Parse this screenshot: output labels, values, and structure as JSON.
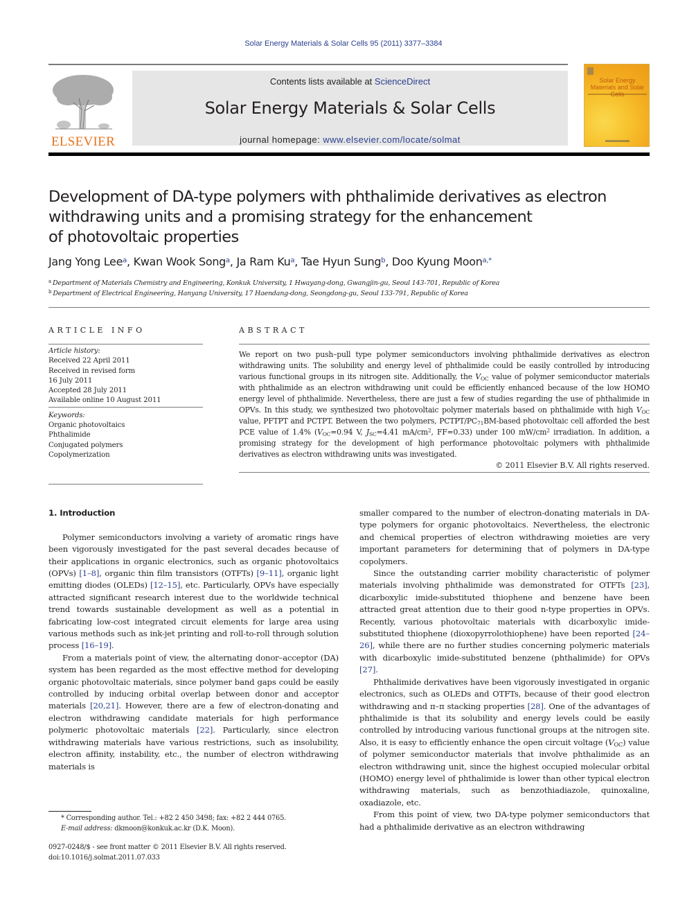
{
  "journal_reference": "Solar Energy Materials & Solar Cells 95 (2011) 3377–3384",
  "masthead": {
    "publisher_wordmark": "ELSEVIER",
    "contents_prefix": "Contents lists available at ",
    "contents_link": "ScienceDirect",
    "journal_name": "Solar Energy Materials & Solar Cells",
    "homepage_prefix": "journal homepage: ",
    "homepage_link": "www.elsevier.com/locate/solmat",
    "cover_title": "Solar Energy Materials and Solar Cells",
    "brand_color": "#e8731c",
    "link_color": "#2a3f8f"
  },
  "article": {
    "title": "Development of DA-type polymers with phthalimide derivatives as electron withdrawing units and a promising strategy for the enhancement of photovoltaic properties",
    "title_lines": [
      "Development of DA-type polymers with phthalimide derivatives as electron",
      "withdrawing units and a promising strategy for the enhancement",
      "of photovoltaic properties"
    ],
    "authors": [
      {
        "name": "Jang Yong Lee",
        "aff": "a",
        "sep": ", "
      },
      {
        "name": "Kwan Wook Song",
        "aff": "a",
        "sep": ", "
      },
      {
        "name": "Ja Ram Ku",
        "aff": "a",
        "sep": ", "
      },
      {
        "name": "Tae Hyun Sung",
        "aff": "b",
        "sep": ", "
      },
      {
        "name": "Doo Kyung Moon",
        "aff": "a,*",
        "sep": ""
      }
    ],
    "affiliations": [
      {
        "mark": "a",
        "text": "Department of Materials Chemistry and Engineering, Konkuk University, 1 Hwayang-dong, Gwangjin-gu, Seoul 143-701, Republic of Korea"
      },
      {
        "mark": "b",
        "text": "Department of Electrical Engineering, Hanyang University, 17 Haendang-dong, Seongdong-gu, Seoul 133-791, Republic of Korea"
      }
    ]
  },
  "article_info": {
    "heading": "ARTICLE INFO",
    "history_label": "Article history:",
    "history": [
      "Received 22 April 2011",
      "Received in revised form",
      "16 July 2011",
      "Accepted 28 July 2011",
      "Available online 10 August 2011"
    ],
    "keywords_label": "Keywords:",
    "keywords": [
      "Organic photovoltaics",
      "Phthalimide",
      "Conjugated polymers",
      "Copolymerization"
    ]
  },
  "abstract": {
    "heading": "ABSTRACT",
    "segments": [
      {
        "t": "We report on two push–pull type polymer semiconductors involving phthalimide derivatives as electron withdrawing units. The solubility and energy level of phthalimide could be easily controlled by introducing various functional groups in its nitrogen site. Additionally, the "
      },
      {
        "t": "V",
        "s": "it"
      },
      {
        "t": "OC",
        "s": "sub"
      },
      {
        "t": " value of polymer semiconductor materials with phthalimide as an electron withdrawing unit could be efficiently enhanced because of the low HOMO energy level of phthalimide. Nevertheless, there are just a few of studies regarding the use of phthalimide in OPVs. In this study, we synthesized two photovoltaic polymer materials based on phthalimide with high "
      },
      {
        "t": "V",
        "s": "it"
      },
      {
        "t": "OC",
        "s": "sub"
      },
      {
        "t": " value, PFTPT and PCTPT. Between the two polymers, PCTPT/PC"
      },
      {
        "t": "71",
        "s": "sub"
      },
      {
        "t": "BM-based photovoltaic cell afforded the best PCE value of 1.4% ("
      },
      {
        "t": "V",
        "s": "it"
      },
      {
        "t": "OC",
        "s": "sub"
      },
      {
        "t": "=0.94 V, "
      },
      {
        "t": "J",
        "s": "it"
      },
      {
        "t": "SC",
        "s": "sub"
      },
      {
        "t": "=4.41 mA/cm"
      },
      {
        "t": "2",
        "s": "sup"
      },
      {
        "t": ", FF=0.33) under 100 mW/cm"
      },
      {
        "t": "2",
        "s": "sup"
      },
      {
        "t": " irradiation. In addition, a promising strategy for the development of high performance photovoltaic polymers with phthalimide derivatives as electron withdrawing units was investigated."
      }
    ],
    "copyright": "© 2011 Elsevier B.V. All rights reserved."
  },
  "body": {
    "section_heading": "1.  Introduction",
    "left_paragraphs": [
      [
        {
          "t": "Polymer semiconductors involving a variety of aromatic rings have been vigorously investigated for the past several decades because of their applications in organic electronics, such as organic photovoltaics (OPVs) "
        },
        {
          "t": "[1–8]",
          "s": "ref"
        },
        {
          "t": ", organic thin film transistors (OTFTs) "
        },
        {
          "t": "[9–11]",
          "s": "ref"
        },
        {
          "t": ", organic light emitting diodes (OLEDs) "
        },
        {
          "t": "[12–15]",
          "s": "ref"
        },
        {
          "t": ", etc. Particularly, OPVs have especially attracted significant research interest due to the worldwide technical trend towards sustainable development as well as a potential in fabricating low-cost integrated circuit elements for large area using various methods such as ink-jet printing and roll-to-roll through solution process "
        },
        {
          "t": "[16–19]",
          "s": "ref"
        },
        {
          "t": "."
        }
      ],
      [
        {
          "t": "From a materials point of view, the alternating donor–acceptor (DA) system has been regarded as the most effective method for developing organic photovoltaic materials, since polymer band gaps could be easily controlled by inducing orbital overlap between donor and acceptor materials "
        },
        {
          "t": "[20,21]",
          "s": "ref"
        },
        {
          "t": ". However, there are a few of electron-donating and electron withdrawing candi­date materials for high performance polymeric photovoltaic materials "
        },
        {
          "t": "[22]",
          "s": "ref"
        },
        {
          "t": ". Particularly, since electron withdrawing materials have various restrictions, such as insolubility, electron affinity, instability, etc., the number of electron withdrawing materials is"
        }
      ]
    ],
    "right_paragraphs": [
      [
        {
          "t": "smaller compared to the number of electron-donating materials in DA-type polymers for organic photovoltaics. Nevertheless, the electronic and chemical properties of electron withdrawing moi­eties are very important parameters for determining that of polymers in DA-type copolymers."
        }
      ],
      [
        {
          "t": "Since the outstanding carrier mobility characteristic of poly­mer materials involving phthalimide was demonstrated for OTFTs "
        },
        {
          "t": "[23]",
          "s": "ref"
        },
        {
          "t": ", dicarboxylic imide-substituted thiophene and benzene have been attracted great attention due to their good n-type properties in OPVs. Recently, various photovoltaic materials with dicar­boxylic imide-substituted thiophene (dioxopyrrolothiophene) have been reported "
        },
        {
          "t": "[24–26]",
          "s": "ref"
        },
        {
          "t": ", while there are no further studies concerning polymeric materials with dicarboxylic imide-substi­tuted benzene (phthalimide) for OPVs "
        },
        {
          "t": "[27]",
          "s": "ref"
        },
        {
          "t": "."
        }
      ],
      [
        {
          "t": "Phthalimide derivatives have been vigorously investigated in organic electronics, such as OLEDs and OTFTs, because of their good electron withdrawing and π–π stacking properties "
        },
        {
          "t": "[28]",
          "s": "ref"
        },
        {
          "t": ". One of the advantages of phthalimide is that its solubility and energy levels could be easily controlled by introducing various functional groups at the nitrogen site. Also, it is easy to efficiently enhance the open circuit voltage ("
        },
        {
          "t": "V",
          "s": "it"
        },
        {
          "t": "OC",
          "s": "sub"
        },
        {
          "t": ") value of polymer semiconductor materi­als that involve phthalimide as an electron withdrawing unit, since the highest occupied molecular orbital (HOMO) energy level of phthalimide is lower than other typical electron withdrawing materials, such as benzothiadiazole, quinoxaline, oxadiazole, etc."
        }
      ],
      [
        {
          "t": "From this point of view, two DA-type polymer semiconductors that had a phthalimide derivative as an electron withdrawing"
        }
      ]
    ]
  },
  "footnotes": {
    "corresponding": "* Corresponding author. Tel.: +82 2 450 3498; fax: +82 2 444 0765.",
    "email_label": "E-mail address:",
    "email": " dkmoon@konkuk.ac.kr (D.K. Moon).",
    "front_matter": "0927-0248/$ - see front matter © 2011 Elsevier B.V. All rights reserved.",
    "doi": "doi:10.1016/j.solmat.2011.07.033"
  }
}
